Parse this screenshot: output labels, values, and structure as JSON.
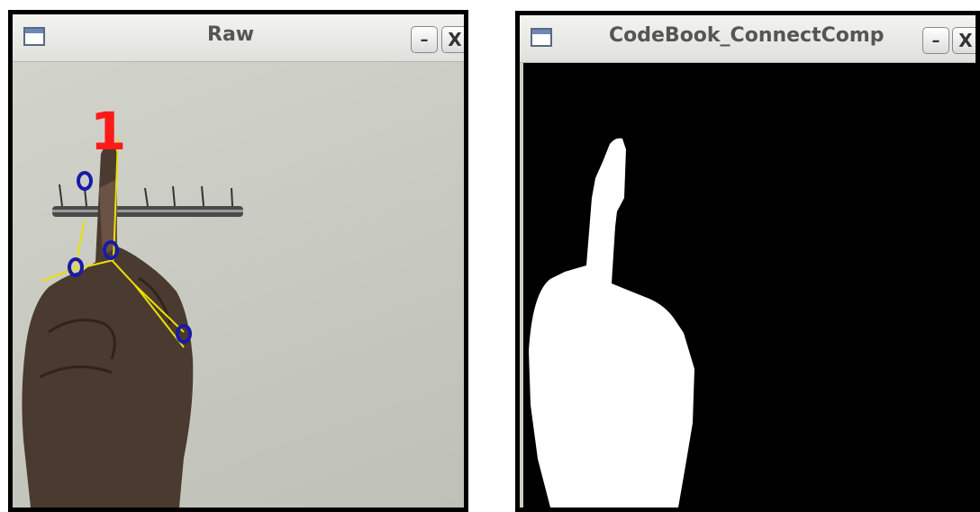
{
  "windows": [
    {
      "title": "Raw",
      "minimize_glyph": "–",
      "close_glyph": "X",
      "icon": "window-icon",
      "overlay_label": "1"
    },
    {
      "title": "CodeBook_ConnectComp",
      "minimize_glyph": "–",
      "close_glyph": "X",
      "icon": "window-icon"
    }
  ],
  "colors": {
    "overlay_label": "#ff1a1a",
    "contour": "#e8e000",
    "defect_points": "#1a1aa8",
    "mask_foreground": "#ffffff",
    "mask_background": "#000000"
  }
}
